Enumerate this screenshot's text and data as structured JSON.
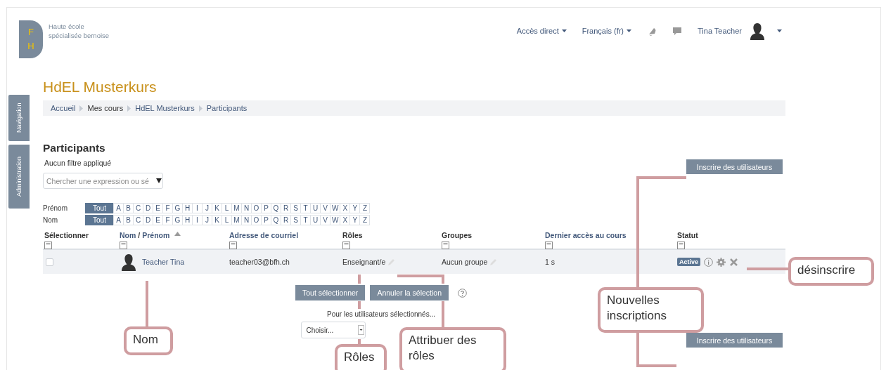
{
  "header": {
    "logo": {
      "letters": [
        "F",
        "H"
      ],
      "lines": [
        "Haute école",
        "spécialisée bernoise"
      ]
    },
    "menus": [
      {
        "label": "Accès direct"
      },
      {
        "label": "Français (fr)"
      }
    ],
    "user_name": "Tina Teacher"
  },
  "side_tabs": [
    "Navigation",
    "Administration"
  ],
  "course_title": "HdEL Musterkurs",
  "breadcrumb": [
    {
      "label": "Accueil",
      "link": true
    },
    {
      "label": "Mes cours",
      "link": false
    },
    {
      "label": "HdEL Musterkurs",
      "link": true
    },
    {
      "label": "Participants",
      "link": true
    }
  ],
  "heading": "Participants",
  "filter_status": "Aucun filtre appliqué",
  "search": {
    "placeholder": "Chercher une expression ou sé"
  },
  "enrol_buttons": [
    "Inscrire des utilisateurs",
    "Inscrire des utilisateurs"
  ],
  "initials_bars": [
    {
      "label": "Prénom",
      "items": [
        {
          "label": "Tout",
          "selected": true
        },
        {
          "label": "A",
          "selected": false
        },
        {
          "label": "B",
          "selected": false
        },
        {
          "label": "C",
          "selected": false
        },
        {
          "label": "D",
          "selected": false
        },
        {
          "label": "E",
          "selected": false
        },
        {
          "label": "F",
          "selected": false
        },
        {
          "label": "G",
          "selected": false
        },
        {
          "label": "H",
          "selected": false
        },
        {
          "label": "I",
          "selected": false
        },
        {
          "label": "J",
          "selected": false
        },
        {
          "label": "K",
          "selected": false
        },
        {
          "label": "L",
          "selected": false
        },
        {
          "label": "M",
          "selected": false
        },
        {
          "label": "N",
          "selected": false
        },
        {
          "label": "O",
          "selected": false
        },
        {
          "label": "P",
          "selected": false
        },
        {
          "label": "Q",
          "selected": false
        },
        {
          "label": "R",
          "selected": false
        },
        {
          "label": "S",
          "selected": false
        },
        {
          "label": "T",
          "selected": false
        },
        {
          "label": "U",
          "selected": false
        },
        {
          "label": "V",
          "selected": false
        },
        {
          "label": "W",
          "selected": false
        },
        {
          "label": "X",
          "selected": false
        },
        {
          "label": "Y",
          "selected": false
        },
        {
          "label": "Z",
          "selected": false
        }
      ]
    },
    {
      "label": "Nom",
      "items": [
        {
          "label": "Tout",
          "selected": true
        },
        {
          "label": "A",
          "selected": false
        },
        {
          "label": "B",
          "selected": false
        },
        {
          "label": "C",
          "selected": false
        },
        {
          "label": "D",
          "selected": false
        },
        {
          "label": "E",
          "selected": false
        },
        {
          "label": "F",
          "selected": false
        },
        {
          "label": "G",
          "selected": false
        },
        {
          "label": "H",
          "selected": false
        },
        {
          "label": "I",
          "selected": false
        },
        {
          "label": "J",
          "selected": false
        },
        {
          "label": "K",
          "selected": false
        },
        {
          "label": "L",
          "selected": false
        },
        {
          "label": "M",
          "selected": false
        },
        {
          "label": "N",
          "selected": false
        },
        {
          "label": "O",
          "selected": false
        },
        {
          "label": "P",
          "selected": false
        },
        {
          "label": "Q",
          "selected": false
        },
        {
          "label": "R",
          "selected": false
        },
        {
          "label": "S",
          "selected": false
        },
        {
          "label": "T",
          "selected": false
        },
        {
          "label": "U",
          "selected": false
        },
        {
          "label": "V",
          "selected": false
        },
        {
          "label": "W",
          "selected": false
        },
        {
          "label": "X",
          "selected": false
        },
        {
          "label": "Y",
          "selected": false
        },
        {
          "label": "Z",
          "selected": false
        }
      ]
    }
  ],
  "table": {
    "columns": [
      {
        "labels": [
          "Sélectionner"
        ],
        "link": false
      },
      {
        "labels": [
          "Nom",
          "Prénom"
        ],
        "separator": "/",
        "link": true,
        "sorted": true
      },
      {
        "labels": [
          "Adresse de courriel"
        ],
        "link": true
      },
      {
        "labels": [
          "Rôles"
        ],
        "link": false
      },
      {
        "labels": [
          "Groupes"
        ],
        "link": false
      },
      {
        "labels": [
          "Dernier accès au cours"
        ],
        "link": true
      },
      {
        "labels": [
          "Statut"
        ],
        "link": false
      }
    ],
    "rows": [
      {
        "selected": false,
        "name": "Teacher Tina",
        "email": "teacher03@bfh.ch",
        "roles": "Enseignant/e",
        "groups": "Aucun groupe",
        "last_access": "1 s",
        "status": "Active"
      }
    ]
  },
  "bulk": {
    "buttons": [
      "Tout sélectionner",
      "Annuler la sélection"
    ],
    "label": "Pour les utilisateurs sélectionnés...",
    "select": {
      "value": "Choisir..."
    }
  },
  "annotations": [
    {
      "text": "Nom"
    },
    {
      "text": "Rôles"
    },
    {
      "text": "Attribuer des rôles"
    },
    {
      "text": "Nouvelles inscriptions"
    },
    {
      "text": "désinscrire"
    }
  ]
}
